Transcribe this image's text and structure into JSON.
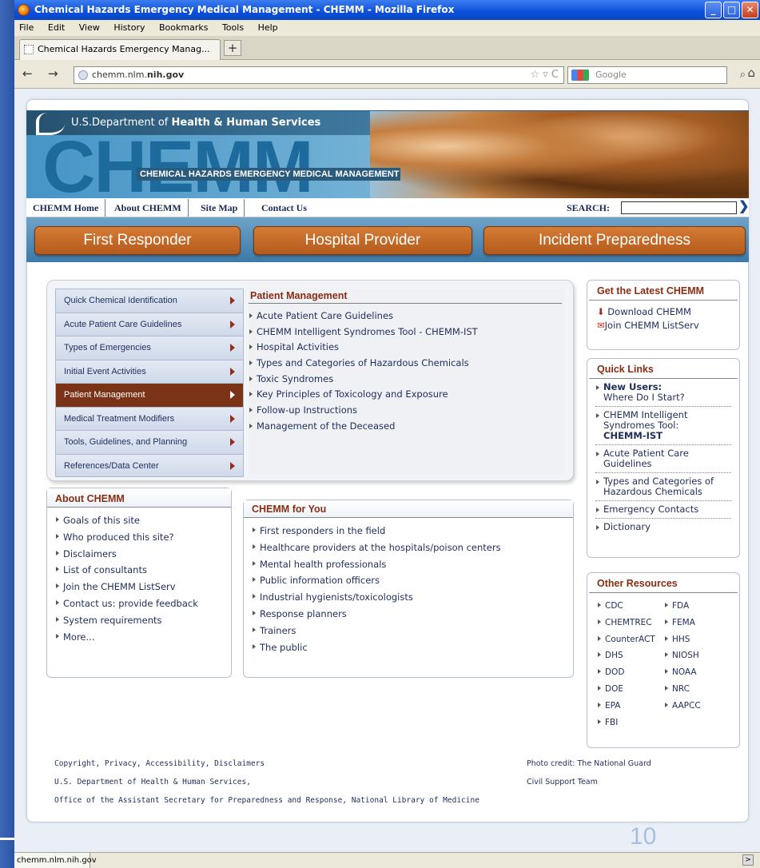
{
  "window": {
    "title": "Chemical Hazards Emergency Medical Management - CHEMM - Mozilla Firefox"
  },
  "menu": [
    "File",
    "Edit",
    "View",
    "History",
    "Bookmarks",
    "Tools",
    "Help"
  ],
  "tab": {
    "label": "Chemical Hazards Emergency Manag...",
    "new_tab": "+"
  },
  "url": {
    "prefix": "chemm.nlm.",
    "host": "nih.gov"
  },
  "search_engine": {
    "placeholder": "Google"
  },
  "banner": {
    "hhs_prefix": "U.S.Department of ",
    "hhs_bold": "Health & Human Services",
    "logo": "CHEMM",
    "subtitle": "CHEMICAL HAZARDS EMERGENCY MEDICAL MANAGEMENT"
  },
  "topnav": {
    "items": [
      "CHEMM Home",
      "About CHEMM",
      "Site Map",
      "Contact Us"
    ],
    "search_label": "SEARCH:"
  },
  "categories": [
    "First Responder",
    "Hospital Provider",
    "Incident Preparedness"
  ],
  "leftnav": [
    "Quick Chemical Identification",
    "Acute Patient Care Guidelines",
    "Types of Emergencies",
    "Initial Event Activities",
    "Patient Management",
    "Medical Treatment Modifiers",
    "Tools, Guidelines, and Planning",
    "References/Data Center"
  ],
  "patient_management": {
    "title": "Patient Management",
    "items": [
      "Acute Patient Care Guidelines",
      "CHEMM Intelligent Syndromes Tool - CHEMM-IST",
      "Hospital Activities",
      "Types and Categories of Hazardous Chemicals",
      "Toxic Syndromes",
      "Key Principles of Toxicology and Exposure",
      "Follow-up Instructions",
      "Management of the Deceased"
    ]
  },
  "about": {
    "title": "About CHEMM",
    "items": [
      "Goals of this site",
      "Who produced this site?",
      "Disclaimers",
      "List of consultants",
      "Join the CHEMM ListServ",
      "Contact us: provide feedback",
      "System requirements",
      "More..."
    ]
  },
  "for_you": {
    "title": "CHEMM for You",
    "items": [
      "First responders in the field",
      "Healthcare providers at the hospitals/poison centers",
      "Mental health professionals",
      "Public information officers",
      "Industrial hygienists/toxicologists",
      "Response planners",
      "Trainers",
      "The public"
    ]
  },
  "latest": {
    "title": "Get the Latest CHEMM",
    "download": "Download CHEMM",
    "join": "Join CHEMM ListServ"
  },
  "quick_links": {
    "title": "Quick Links",
    "new_users_bold": "New Users:",
    "new_users_rest": "Where Do I Start?",
    "ist_text": "CHEMM Intelligent Syndromes Tool:",
    "ist_bold": "CHEMM-IST",
    "items": [
      "Acute Patient Care Guidelines",
      "Types and Categories of Hazardous Chemicals",
      "Emergency Contacts",
      "Dictionary"
    ]
  },
  "resources": {
    "title": "Other Resources",
    "items": [
      "CDC",
      "FDA",
      "CHEMTREC",
      "FEMA",
      "CounterACT",
      "HHS",
      "DHS",
      "NIOSH",
      "DOD",
      "NOAA",
      "DOE",
      "NRC",
      "EPA",
      "AAPCC",
      "FBI"
    ]
  },
  "footer": {
    "line1": "Copyright, Privacy, Accessibility, Disclaimers",
    "line2": "U.S. Department of Health & Human Services,",
    "line3": "Office of the Assistant Secretary for Preparedness and Response, National Library of Medicine",
    "credit1": "Photo credit: The National Guard",
    "credit2": "Civil Support Team"
  },
  "status": {
    "text": "chemm.nlm.nih.gov",
    "slide_number": "10"
  }
}
